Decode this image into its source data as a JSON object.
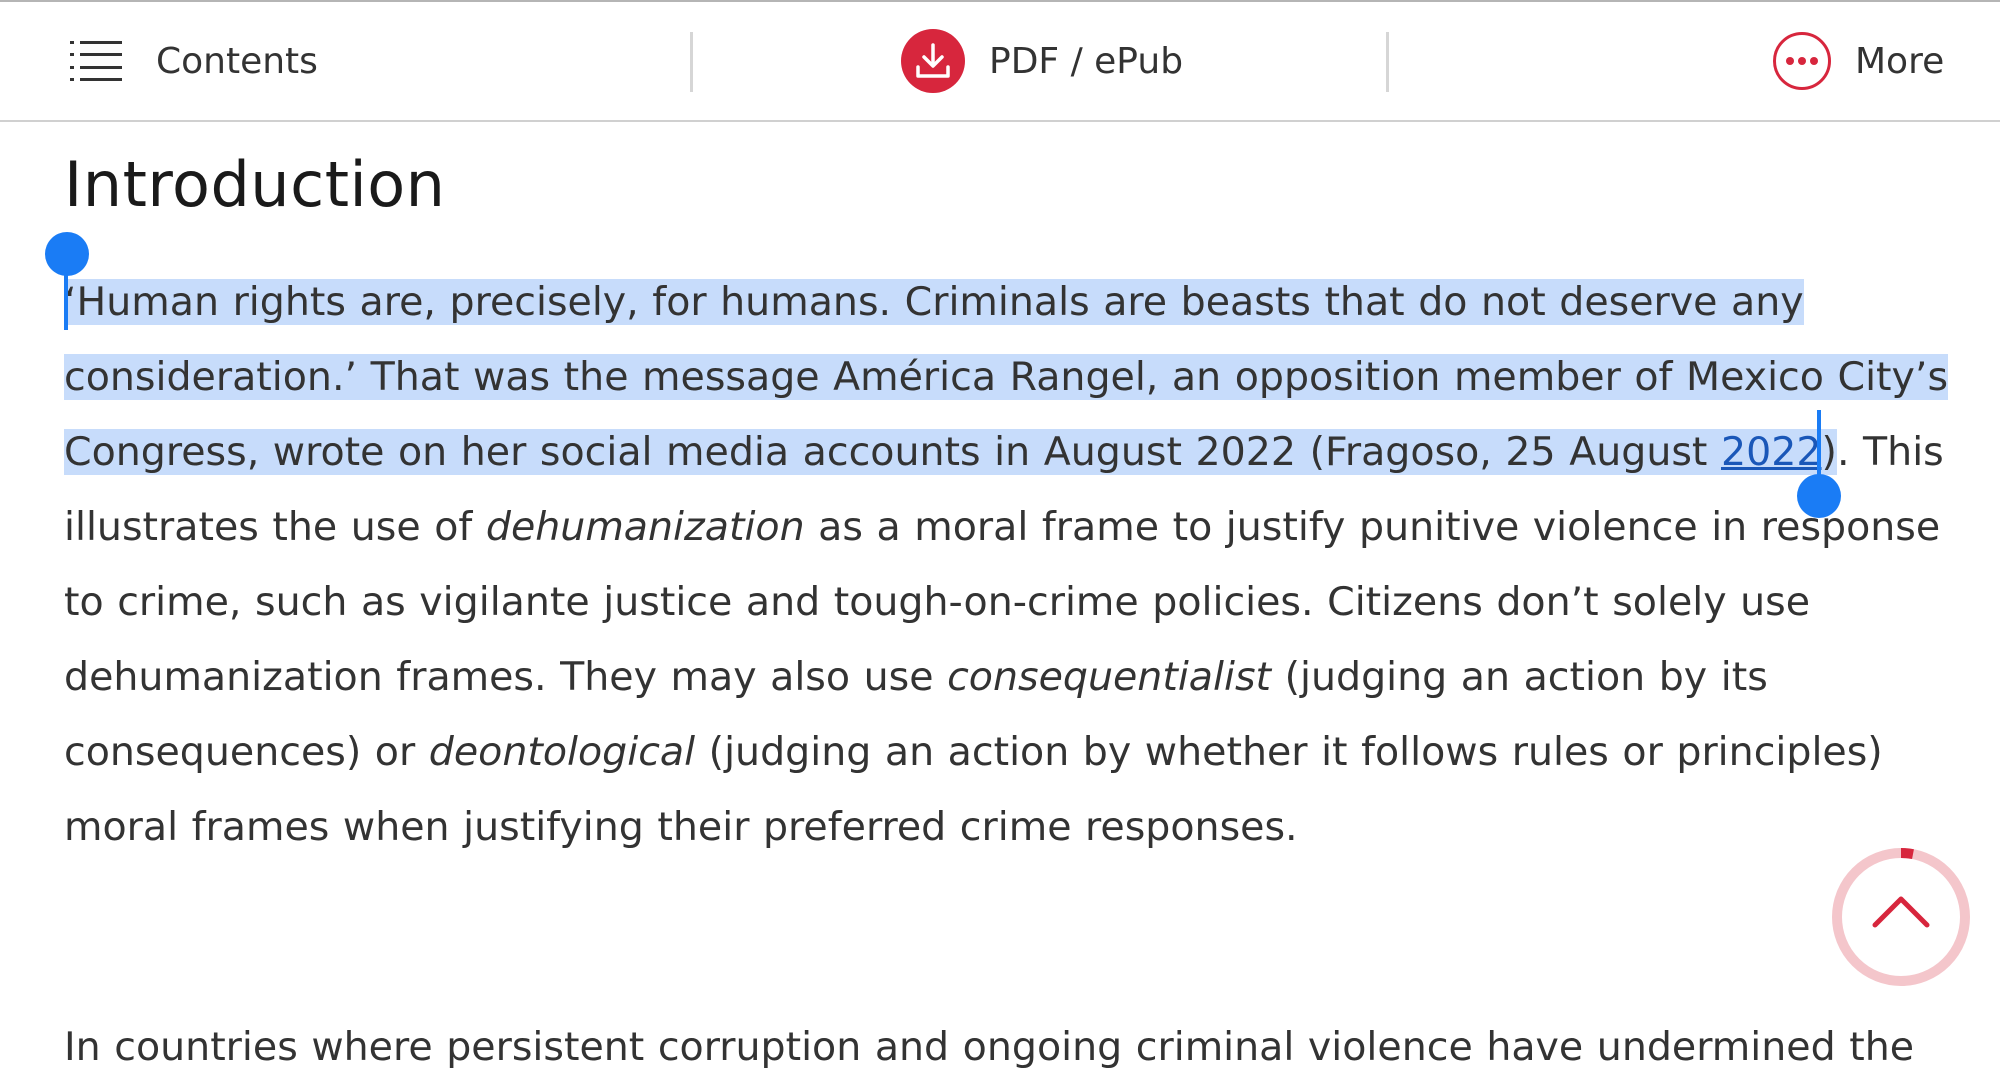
{
  "toolbar": {
    "contents_label": "Contents",
    "pdf_label": "PDF / ePub",
    "more_label": "More"
  },
  "article": {
    "heading": "Introduction",
    "p1": {
      "selected_text": "‘Human rights are, precisely, for humans. Criminals are beasts that do not deserve any consideration.’ That was the message América Rangel, an opposition member of Mexico City’s Congress, wrote on her social media accounts in August 2022 (Fragoso, 25 August ",
      "citation_year": "2022",
      "selected_close": ")",
      "after_selection": ". This illustrates the use of ",
      "em1": "dehumanization",
      "t2": " as a moral frame to justify punitive violence in response to crime, such as vigilante justice and tough-on-crime policies. Citizens don’t solely use dehumanization frames. They may also use ",
      "em2": "consequentialist",
      "t3": " (judging an action by its consequences) or ",
      "em3": "deontological",
      "t4": " (judging an action by whether it follows rules or principles) moral frames when justifying their preferred crime responses."
    },
    "p2_text": "In countries where persistent corruption and ongoing criminal violence have undermined the"
  },
  "colors": {
    "accent_red": "#d7263d",
    "selection": "#c7dcfb",
    "handle_blue": "#1a7cf5",
    "link_blue": "#1a57b8"
  },
  "icons": {
    "contents": "list-icon",
    "pdf": "download-icon",
    "more": "ellipsis-icon",
    "scroll_top": "chevron-up-icon"
  },
  "reading_progress": 0.03
}
